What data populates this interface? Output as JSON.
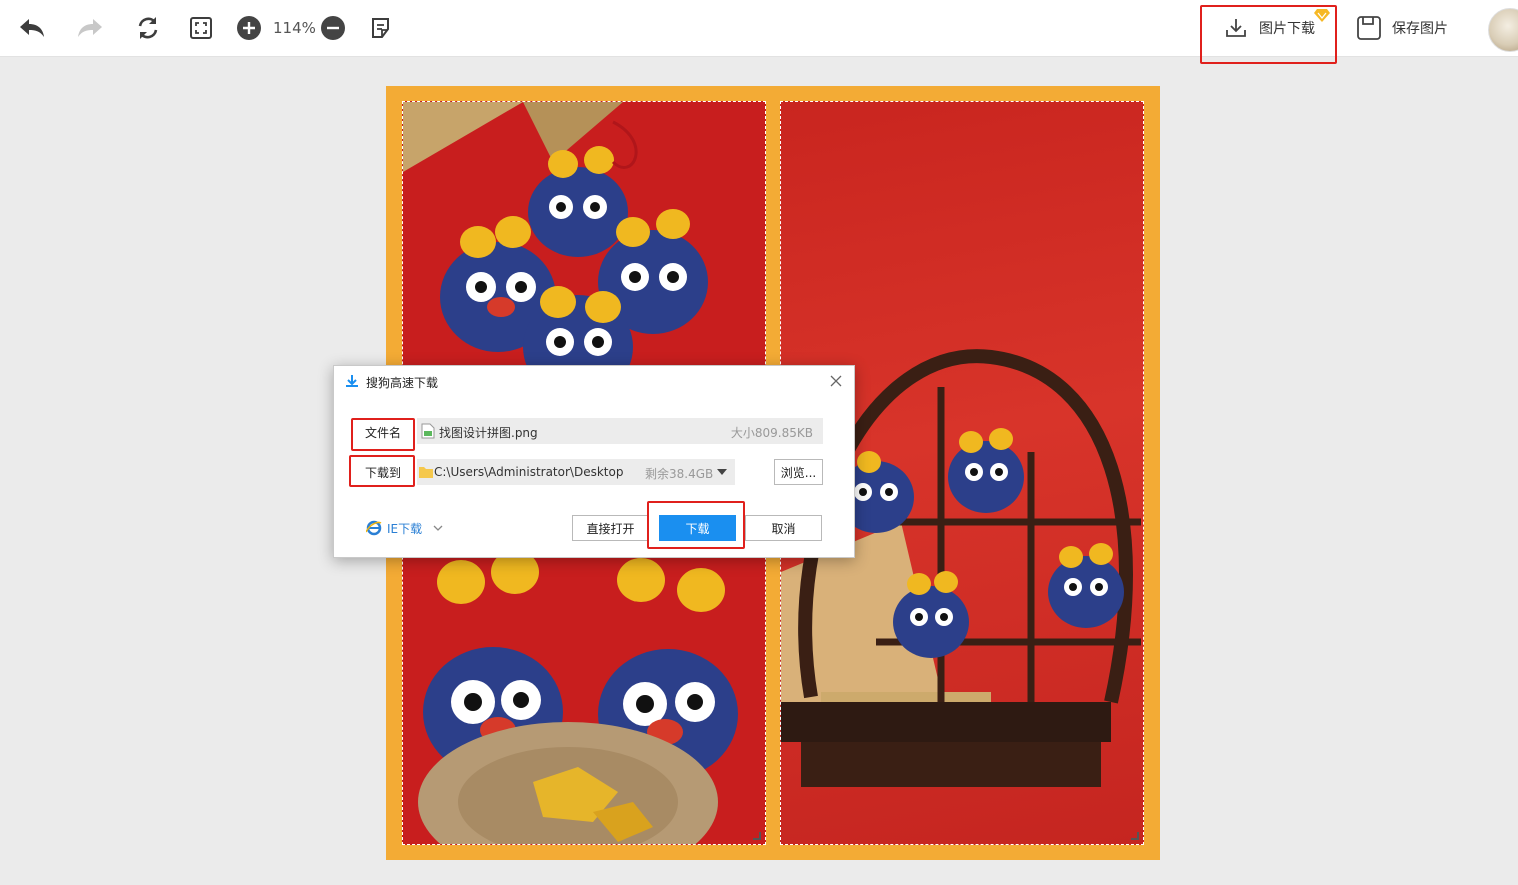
{
  "toolbar": {
    "zoom_level": "114%",
    "download_label": "图片下载",
    "save_label": "保存图片"
  },
  "dialog": {
    "title": "搜狗高速下载",
    "filename_label": "文件名",
    "filename_value": "找图设计拼图.png",
    "filesize": "大小809.85KB",
    "save_to_label": "下载到",
    "save_path": "C:\\Users\\Administrator\\Desktop",
    "free_space": "剩余38.4GB",
    "browse_label": "浏览...",
    "ie_download_label": "IE下载",
    "open_direct_label": "直接打开",
    "download_label": "下载",
    "cancel_label": "取消"
  },
  "colors": {
    "canvas_border": "#f3ab35",
    "highlight": "#e0201c",
    "primary_button": "#1a8ff0",
    "photo_red": "#c81e1e"
  }
}
